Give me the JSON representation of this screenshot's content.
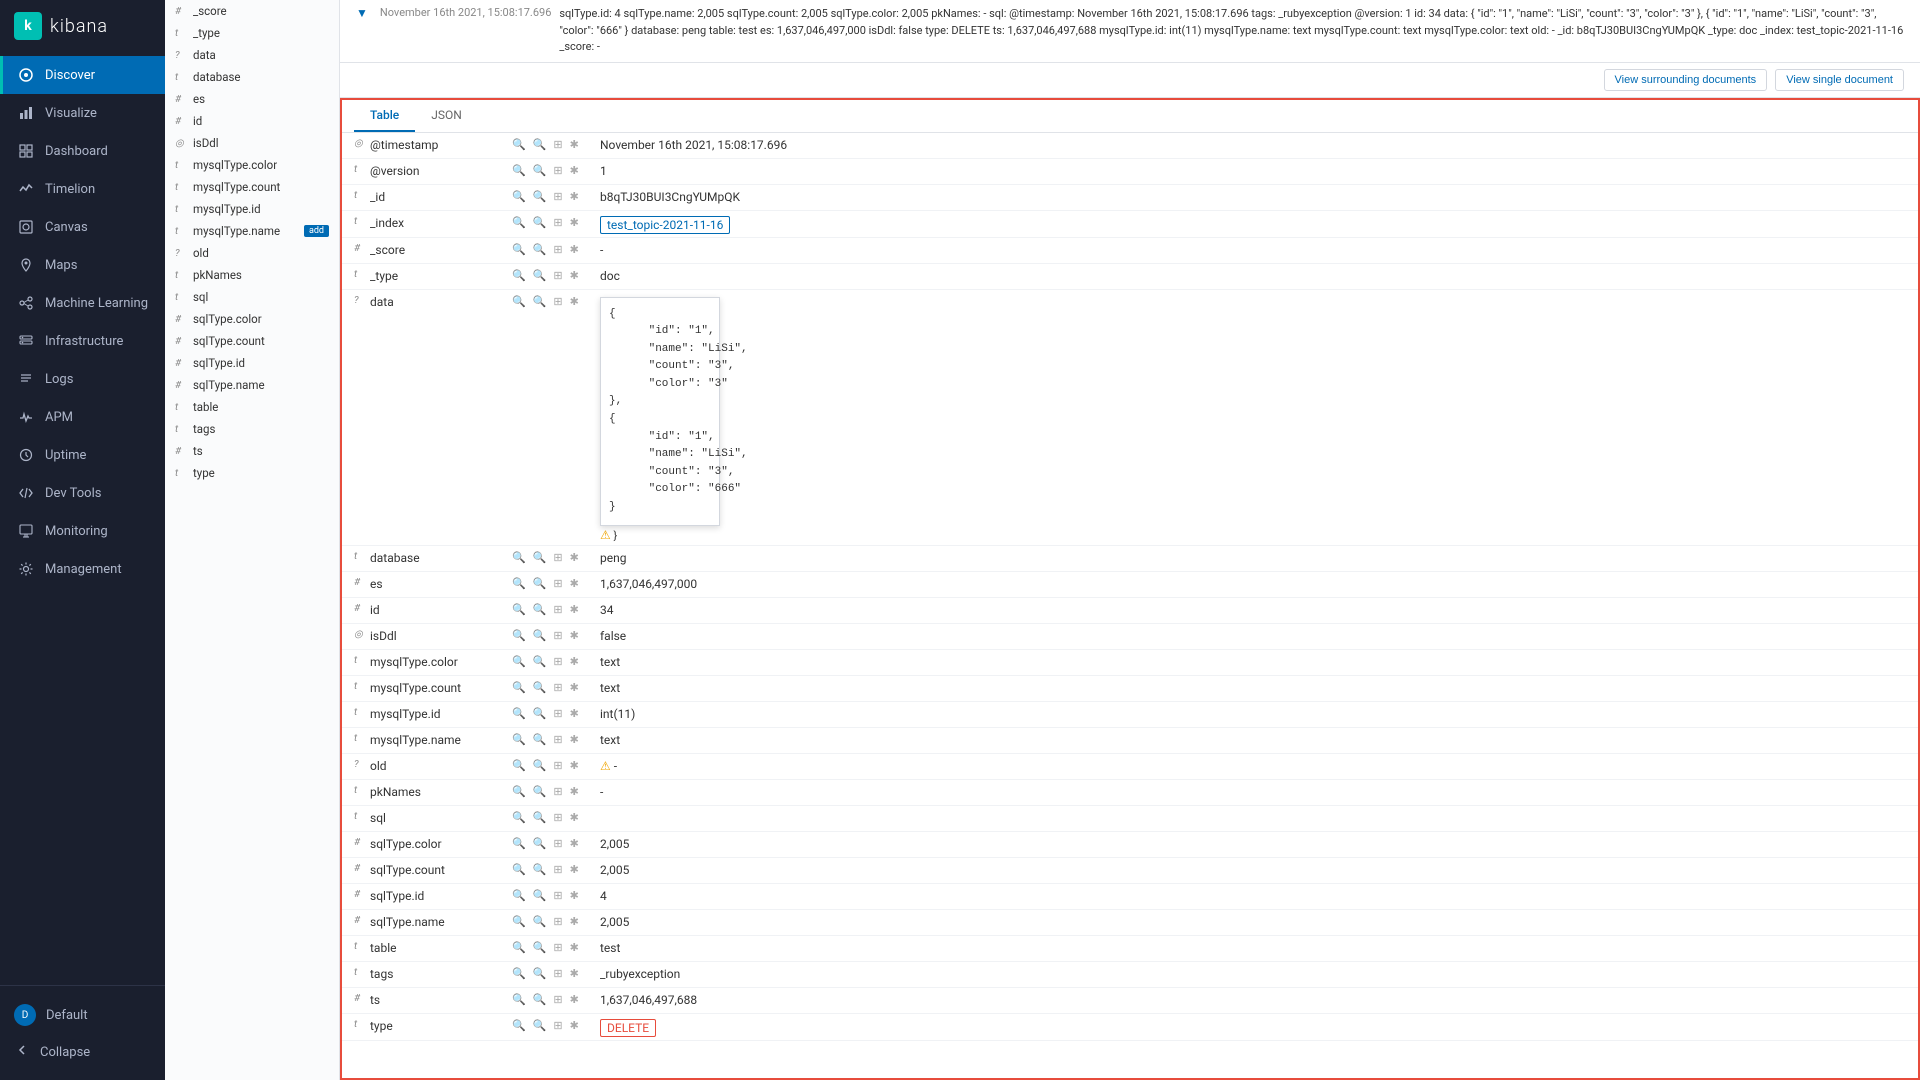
{
  "app": {
    "title": "kibana"
  },
  "sidebar": {
    "nav_items": [
      {
        "id": "discover",
        "label": "Discover",
        "active": true,
        "icon": "compass"
      },
      {
        "id": "visualize",
        "label": "Visualize",
        "active": false,
        "icon": "bar-chart"
      },
      {
        "id": "dashboard",
        "label": "Dashboard",
        "active": false,
        "icon": "grid"
      },
      {
        "id": "timelion",
        "label": "Timelion",
        "active": false,
        "icon": "timelion"
      },
      {
        "id": "canvas",
        "label": "Canvas",
        "active": false,
        "icon": "canvas"
      },
      {
        "id": "maps",
        "label": "Maps",
        "active": false,
        "icon": "map"
      },
      {
        "id": "ml",
        "label": "Machine Learning",
        "active": false,
        "icon": "ml"
      },
      {
        "id": "infra",
        "label": "Infrastructure",
        "active": false,
        "icon": "infra"
      },
      {
        "id": "logs",
        "label": "Logs",
        "active": false,
        "icon": "logs"
      },
      {
        "id": "apm",
        "label": "APM",
        "active": false,
        "icon": "apm"
      },
      {
        "id": "uptime",
        "label": "Uptime",
        "active": false,
        "icon": "uptime"
      },
      {
        "id": "devtools",
        "label": "Dev Tools",
        "active": false,
        "icon": "devtools"
      },
      {
        "id": "monitoring",
        "label": "Monitoring",
        "active": false,
        "icon": "monitoring"
      },
      {
        "id": "management",
        "label": "Management",
        "active": false,
        "icon": "management"
      }
    ],
    "bottom": {
      "user": "Default",
      "collapse": "Collapse"
    }
  },
  "fields": [
    {
      "type": "#",
      "name": "_score"
    },
    {
      "type": "t",
      "name": "_type"
    },
    {
      "type": "?",
      "name": "data"
    },
    {
      "type": "t",
      "name": "database"
    },
    {
      "type": "#",
      "name": "es"
    },
    {
      "type": "#",
      "name": "id"
    },
    {
      "type": "◎",
      "name": "isDdl"
    },
    {
      "type": "t",
      "name": "mysqlType.color"
    },
    {
      "type": "t",
      "name": "mysqlType.count"
    },
    {
      "type": "t",
      "name": "mysqlType.id"
    },
    {
      "type": "t",
      "name": "mysqlType.name",
      "add_badge": true
    },
    {
      "type": "?",
      "name": "old"
    },
    {
      "type": "t",
      "name": "pkNames"
    },
    {
      "type": "t",
      "name": "sql"
    },
    {
      "type": "#",
      "name": "sqlType.color"
    },
    {
      "type": "#",
      "name": "sqlType.count"
    },
    {
      "type": "#",
      "name": "sqlType.id"
    },
    {
      "type": "#",
      "name": "sqlType.name"
    },
    {
      "type": "t",
      "name": "table"
    },
    {
      "type": "t",
      "name": "tags"
    },
    {
      "type": "#",
      "name": "ts"
    },
    {
      "type": "t",
      "name": "type"
    }
  ],
  "topbar": {
    "timestamp_display": "November 16th 2021, 15:08:17.696",
    "content": "sqlType.id: 4  sqlType.name: 2,005  sqlType.count: 2,005  sqlType.color: 2,005  pkNames:  - sql:  @timestamp: November 16th 2021, 15:08:17.696  tags: _rubyexception  @version: 1  id: 34  data: { \"id\": \"1\", \"name\": \"LiSi\", \"count\": \"3\", \"color\": \"3\" }, { \"id\": \"1\", \"name\": \"LiSi\", \"count\": \"3\", \"color\": \"666\" }  database: peng  table: test  es: 1,637,046,497,000  isDdl: false  type: DELETE  ts: 1,637,046,497,688  mysqlType.id: int(11)  mysqlType.name: text  mysqlType.count: text  mysqlType.color: text  old: - _id: b8qTJ30BUI3CngYUMpQK  _type: doc  _index: test_topic-2021-11-16  _score: -"
  },
  "actions": {
    "view_surrounding": "View surrounding documents",
    "view_single": "View single document"
  },
  "tabs": [
    {
      "id": "table",
      "label": "Table",
      "active": true
    },
    {
      "id": "json",
      "label": "JSON",
      "active": false
    }
  ],
  "table_rows": [
    {
      "type": "◎",
      "name": "@timestamp",
      "value": "November 16th 2021, 15:08:17.696",
      "value_type": "normal"
    },
    {
      "type": "t",
      "name": "@version",
      "value": "1",
      "value_type": "normal"
    },
    {
      "type": "t",
      "name": "_id",
      "value": "b8qTJ30BUI3CngYUMpQK",
      "value_type": "normal"
    },
    {
      "type": "t",
      "name": "_index",
      "value": "test_topic-2021-11-16",
      "value_type": "blue-box"
    },
    {
      "type": "#",
      "name": "_score",
      "value": "-",
      "value_type": "normal"
    },
    {
      "type": "t",
      "name": "_type",
      "value": "doc",
      "value_type": "normal"
    },
    {
      "type": "?",
      "name": "data",
      "value": "",
      "value_type": "json-popup"
    },
    {
      "type": "t",
      "name": "database",
      "value": "peng",
      "value_type": "normal"
    },
    {
      "type": "#",
      "name": "es",
      "value": "1,637,046,497,000",
      "value_type": "normal"
    },
    {
      "type": "#",
      "name": "id",
      "value": "34",
      "value_type": "normal"
    },
    {
      "type": "◎",
      "name": "isDdl",
      "value": "false",
      "value_type": "normal"
    },
    {
      "type": "t",
      "name": "mysqlType.color",
      "value": "text",
      "value_type": "normal"
    },
    {
      "type": "t",
      "name": "mysqlType.count",
      "value": "text",
      "value_type": "normal"
    },
    {
      "type": "t",
      "name": "mysqlType.id",
      "value": "int(11)",
      "value_type": "normal"
    },
    {
      "type": "t",
      "name": "mysqlType.name",
      "value": "text",
      "value_type": "normal"
    },
    {
      "type": "?",
      "name": "old",
      "value": "-",
      "value_type": "warning"
    },
    {
      "type": "t",
      "name": "pkNames",
      "value": "-",
      "value_type": "normal"
    },
    {
      "type": "t",
      "name": "sql",
      "value": "",
      "value_type": "normal"
    },
    {
      "type": "#",
      "name": "sqlType.color",
      "value": "2,005",
      "value_type": "normal"
    },
    {
      "type": "#",
      "name": "sqlType.count",
      "value": "2,005",
      "value_type": "normal"
    },
    {
      "type": "#",
      "name": "sqlType.id",
      "value": "4",
      "value_type": "normal"
    },
    {
      "type": "#",
      "name": "sqlType.name",
      "value": "2,005",
      "value_type": "normal"
    },
    {
      "type": "t",
      "name": "table",
      "value": "test",
      "value_type": "normal"
    },
    {
      "type": "t",
      "name": "tags",
      "value": "_rubyexception",
      "value_type": "normal"
    },
    {
      "type": "#",
      "name": "ts",
      "value": "1,637,046,497,688",
      "value_type": "normal"
    },
    {
      "type": "t",
      "name": "type",
      "value": "DELETE",
      "value_type": "red-box"
    }
  ],
  "json_data": {
    "line1": "{",
    "line2": "    \"id\": \"1\",",
    "line3": "    \"name\": \"LiSi\",",
    "line4": "    \"count\": \"3\",",
    "line5": "    \"color\": \"3\"",
    "line6": "},",
    "line7": "{",
    "line8": "    \"id\": \"1\",",
    "line9": "    \"name\": \"LiSi\",",
    "line10": "    \"count\": \"3\",",
    "line11": "    \"color\": \"666\"",
    "line12": "}"
  },
  "colors": {
    "sidebar_bg": "#1a1f2e",
    "active_nav": "#006bb4",
    "accent": "#00bfb3",
    "border_red": "#e74c3c",
    "text_link": "#006bb4"
  }
}
